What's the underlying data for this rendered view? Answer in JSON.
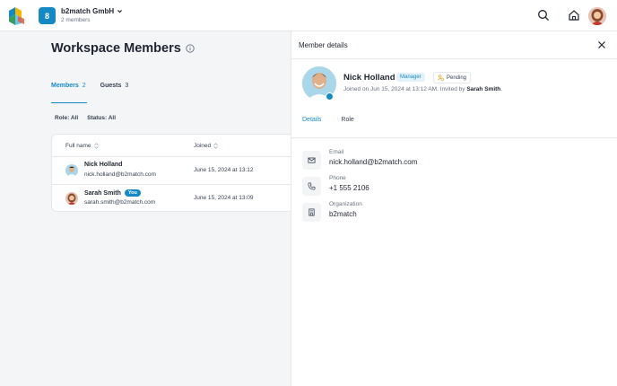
{
  "workspace": {
    "badge_letter": "8",
    "name": "b2match GmbH",
    "members_count": "2 members"
  },
  "page": {
    "title": "Workspace Members",
    "tabs": [
      {
        "label": "Members",
        "count": "2"
      },
      {
        "label": "Guests",
        "count": "3"
      }
    ],
    "filters": {
      "role": "Role: All",
      "status": "Status: All"
    }
  },
  "table": {
    "headers": {
      "full_name": "Full name",
      "joined": "Joined"
    },
    "rows": [
      {
        "name": "Nick Holland",
        "email": "nick.holland@b2match.com",
        "joined": "June 15, 2024 at 13:12",
        "badge": ""
      },
      {
        "name": "Sarah Smith",
        "email": "sarah.smith@b2match.com",
        "joined": "June 15, 2024 at 13:09",
        "badge": "You"
      }
    ]
  },
  "panel": {
    "title": "Member details",
    "name": "Nick Holland",
    "role_badge": "Manager",
    "status_badge": "Pending",
    "joined_prefix": "Joined on Jun 15, 2024 at 13:12 AM. Invited by ",
    "invited_by": "Sarah Smith",
    "joined_suffix": ".",
    "tabs": [
      {
        "label": "Details"
      },
      {
        "label": "Role"
      }
    ],
    "fields": [
      {
        "label": "Email",
        "value": "nick.holland@b2match.com",
        "icon": "mail-icon"
      },
      {
        "label": "Phone",
        "value": "+1 555 2106",
        "icon": "phone-icon"
      },
      {
        "label": "Organization",
        "value": "b2match",
        "icon": "building-icon"
      }
    ]
  },
  "colors": {
    "accent": "#1589c4",
    "border": "#e5e7eb",
    "background": "#f4f5f7"
  }
}
